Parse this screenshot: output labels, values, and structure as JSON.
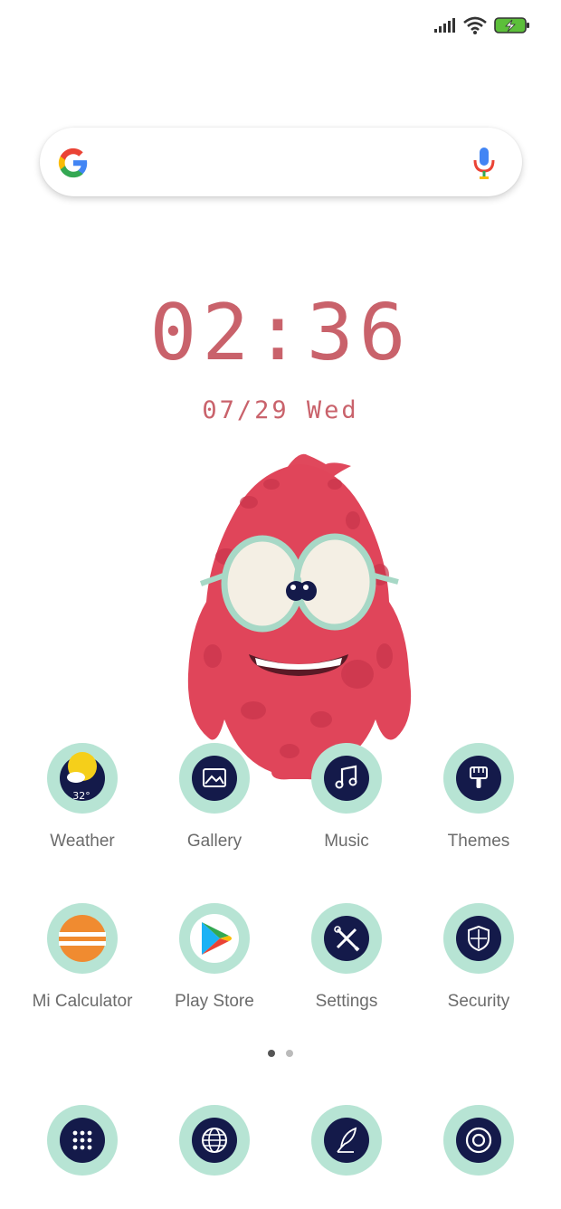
{
  "status_bar": {
    "icons": [
      "signal-icon",
      "wifi-icon",
      "battery-charging-icon"
    ],
    "battery_color": "#5cbf3a"
  },
  "search": {
    "brand": "google-logo",
    "voice": "mic-icon"
  },
  "clock": {
    "time": "02:36",
    "date": "07/29  Wed",
    "color": "#c9626b"
  },
  "apps": [
    {
      "label": "Weather",
      "icon": "weather-icon",
      "temp": "32°"
    },
    {
      "label": "Gallery",
      "icon": "gallery-icon"
    },
    {
      "label": "Music",
      "icon": "music-icon"
    },
    {
      "label": "Themes",
      "icon": "themes-brush-icon"
    },
    {
      "label": "Mi Calculator",
      "icon": "calculator-icon"
    },
    {
      "label": "Play Store",
      "icon": "play-store-icon"
    },
    {
      "label": "Settings",
      "icon": "settings-tools-icon"
    },
    {
      "label": "Security",
      "icon": "security-shield-icon"
    }
  ],
  "page_indicator": {
    "pages": 2,
    "current": 1
  },
  "dock": [
    {
      "icon": "app-drawer-icon"
    },
    {
      "icon": "browser-globe-icon"
    },
    {
      "icon": "notes-quill-icon"
    },
    {
      "icon": "camera-lens-icon"
    }
  ],
  "colors": {
    "icon_ring": "#b7e4d4",
    "icon_inner": "#141a4a",
    "label": "#6b6b6b"
  }
}
